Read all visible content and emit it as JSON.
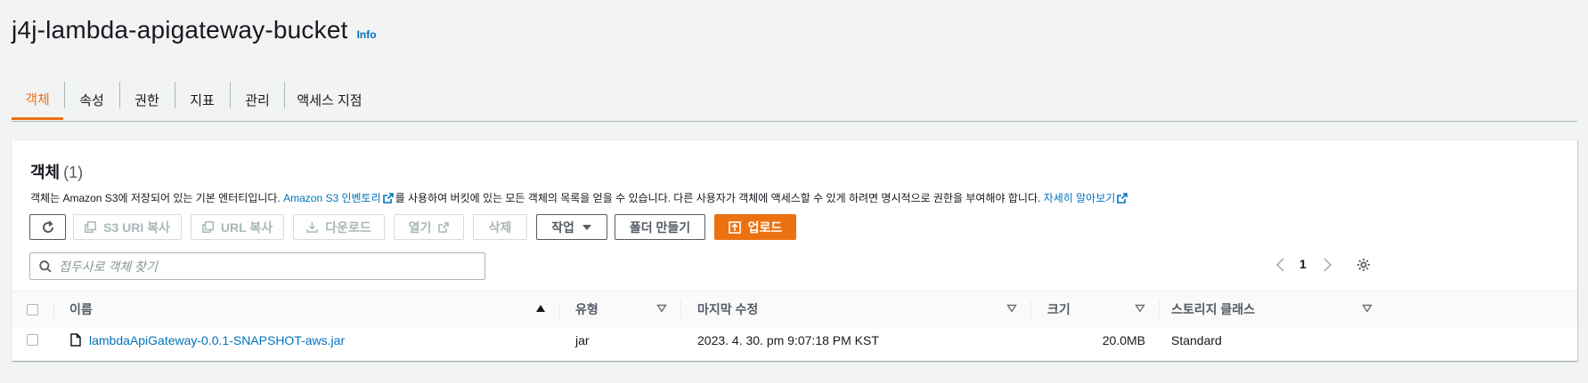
{
  "header": {
    "title": "j4j-lambda-apigateway-bucket",
    "info": "Info"
  },
  "tabs": [
    {
      "label": "객체",
      "active": true
    },
    {
      "label": "속성"
    },
    {
      "label": "권한"
    },
    {
      "label": "지표"
    },
    {
      "label": "관리"
    },
    {
      "label": "액세스 지점"
    }
  ],
  "objects": {
    "title": "객체",
    "count": "(1)",
    "desc_part1": "객체는 Amazon S3에 저장되어 있는 기본 엔터티입니다. ",
    "desc_link1": "Amazon S3 인벤토리",
    "desc_part2": "를 사용하여 버킷에 있는 모든 객체의 목록을 얻을 수 있습니다. 다른 사용자가 객체에 액세스할 수 있게 하려면 명시적으로 권한을 부여해야 합니다. ",
    "desc_link2": "자세히 알아보기"
  },
  "toolbar": {
    "copy_s3_uri": "S3 URI 복사",
    "copy_url": "URL 복사",
    "download": "다운로드",
    "open": "열기",
    "delete": "삭제",
    "actions": "작업",
    "create_folder": "폴더 만들기",
    "upload": "업로드"
  },
  "search": {
    "placeholder": "접두사로 객체 찾기"
  },
  "pagination": {
    "page": "1"
  },
  "table": {
    "columns": {
      "name": "이름",
      "type": "유형",
      "modified": "마지막 수정",
      "size": "크기",
      "storage_class": "스토리지 클래스"
    },
    "rows": [
      {
        "name": "lambdaApiGateway-0.0.1-SNAPSHOT-aws.jar",
        "type": "jar",
        "modified": "2023. 4. 30. pm 9:07:18 PM KST",
        "size": "20.0MB",
        "storage_class": "Standard"
      }
    ]
  },
  "colors": {
    "accent": "#ec7211",
    "link": "#0073bb"
  }
}
